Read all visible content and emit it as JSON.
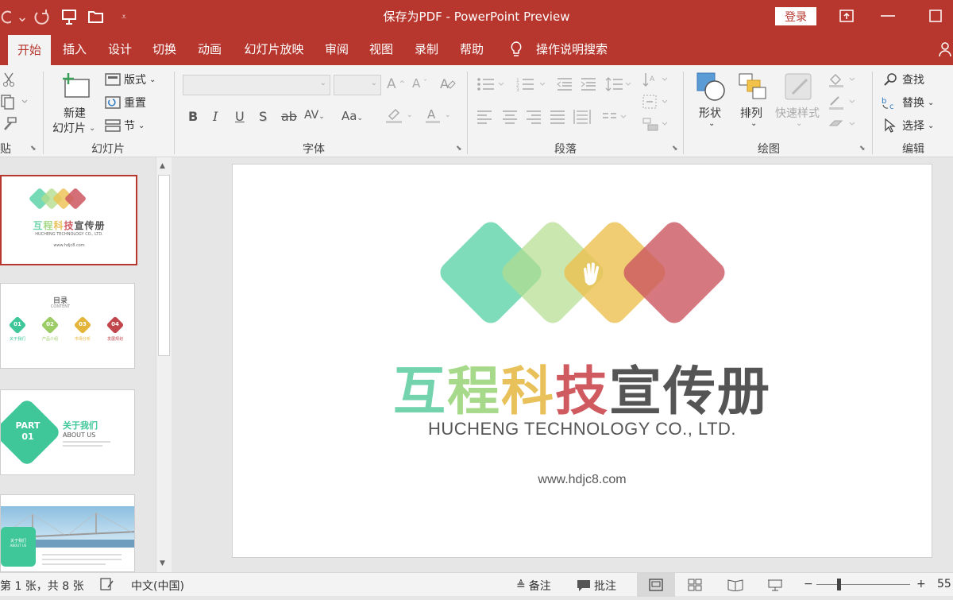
{
  "window": {
    "title": "保存为PDF  -  PowerPoint Preview",
    "login_label": "登录"
  },
  "quick_access": {
    "undo_icon": "undo-icon",
    "redo_icon": "redo-icon",
    "present_icon": "from-beginning-icon",
    "open_icon": "open-folder-icon",
    "customize_icon": "customize-qat-icon"
  },
  "tabs": [
    {
      "label": "开始",
      "active": true
    },
    {
      "label": "插入"
    },
    {
      "label": "设计"
    },
    {
      "label": "切换"
    },
    {
      "label": "动画"
    },
    {
      "label": "幻灯片放映"
    },
    {
      "label": "审阅"
    },
    {
      "label": "视图"
    },
    {
      "label": "录制"
    },
    {
      "label": "帮助"
    }
  ],
  "tell_me": "操作说明搜索",
  "ribbon": {
    "clipboard": {
      "label": "贴板"
    },
    "slides": {
      "label": "幻灯片",
      "new_slide_line1": "新建",
      "new_slide_line2": "幻灯片",
      "layout": "版式",
      "reset": "重置",
      "section": "节"
    },
    "font": {
      "label": "字体",
      "bold": "B",
      "italic": "I",
      "underline": "U",
      "shadow": "S",
      "strike": "ab",
      "spacing": "AV",
      "case": "Aa"
    },
    "paragraph": {
      "label": "段落"
    },
    "drawing": {
      "label": "绘图",
      "shapes": "形状",
      "arrange": "排列",
      "quick_styles": "快速样式"
    },
    "editing": {
      "label": "编辑",
      "find": "查找",
      "replace": "替换",
      "select": "选择"
    }
  },
  "thumbnails": {
    "slide1": {
      "title_parts": [
        "互",
        "程",
        "科",
        "技",
        "宣传册"
      ],
      "subtitle": "HUCHENG TECHNOLOGY CO., LTD.",
      "url": "www.hdjc8.com"
    },
    "slide2": {
      "title": "目录",
      "subtitle": "CONTENT",
      "items": [
        {
          "num": "01",
          "label": "关于我们",
          "color": "#3fc79a"
        },
        {
          "num": "02",
          "label": "产品介绍",
          "color": "#9ccc65"
        },
        {
          "num": "03",
          "label": "市场分析",
          "color": "#e5b53a"
        },
        {
          "num": "04",
          "label": "发展规划",
          "color": "#c0464c"
        }
      ]
    },
    "slide3": {
      "part": "PART",
      "num": "01",
      "title": "关于我们",
      "subtitle": "ABOUT US"
    },
    "slide4": {
      "badge_title": "关于我们",
      "badge_sub": "ABOUT US"
    }
  },
  "slide": {
    "title_parts": [
      {
        "text": "互",
        "color": "#72d3ad"
      },
      {
        "text": "程",
        "color": "#a7d98a"
      },
      {
        "text": "科",
        "color": "#e9c15a"
      },
      {
        "text": "技",
        "color": "#cf5a60"
      },
      {
        "text": "宣传册",
        "color": "#555555"
      }
    ],
    "subtitle": "HUCHENG TECHNOLOGY CO., LTD.",
    "url": "www.hdjc8.com",
    "diamond_colors": [
      "#5ed3a9",
      "#b5dd8e",
      "#ecc04f",
      "#cc5660"
    ],
    "logo_icon": "hand-icon"
  },
  "status": {
    "slide_info": "第 1 张，共 8 张",
    "language": "中文(中国)",
    "notes": "备注",
    "comments": "批注",
    "zoom": "55"
  },
  "colors": {
    "accent": "#b7372e"
  }
}
